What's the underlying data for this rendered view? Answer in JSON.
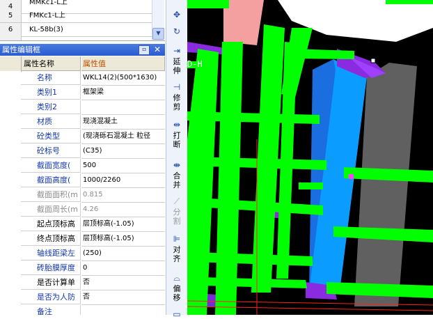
{
  "top_list": {
    "rows": [
      {
        "num": "4",
        "name": "MMKc1-L上"
      },
      {
        "num": "5",
        "name": "FMKc1-L上"
      },
      {
        "num": "6",
        "name": "KL-58b(3)"
      }
    ],
    "scroll_icon": "chevron-down-icon"
  },
  "panel": {
    "title": "属性编辑框",
    "pin_label": "ㅁ",
    "close_label": "✕",
    "header_name": "属性名称",
    "header_value": "属性值",
    "rows": [
      {
        "name": "名称",
        "value": "WKL14(2)(500*1630)",
        "style": "blue"
      },
      {
        "name": "类别1",
        "value": "框架梁",
        "style": "blue"
      },
      {
        "name": "类别2",
        "value": "",
        "style": "blue"
      },
      {
        "name": "材质",
        "value": "现浇混凝土",
        "style": "blue"
      },
      {
        "name": "砼类型",
        "value": "(现浇砾石混凝土 粒径",
        "style": "blue"
      },
      {
        "name": "砼标号",
        "value": "(C35)",
        "style": "blue"
      },
      {
        "name": "截面宽度(",
        "value": "500",
        "style": "blue"
      },
      {
        "name": "截面高度(",
        "value": "1000/2260",
        "style": "blue"
      },
      {
        "name": "截面面积(m",
        "value": "0.815",
        "style": "gray"
      },
      {
        "name": "截面周长(m",
        "value": "4.26",
        "style": "gray"
      },
      {
        "name": "起点顶标高",
        "value": "层顶标高(-1.05)",
        "style": "black"
      },
      {
        "name": "终点顶标高",
        "value": "层顶标高(-1.05)",
        "style": "black"
      },
      {
        "name": "轴线距梁左",
        "value": "(250)",
        "style": "blue"
      },
      {
        "name": "砖胎膜厚度",
        "value": "0",
        "style": "blue"
      },
      {
        "name": "是否计算单",
        "value": "否",
        "style": "black"
      },
      {
        "name": "是否为人防",
        "value": "否",
        "style": "blue"
      },
      {
        "name": "备注",
        "value": "",
        "style": "blue"
      }
    ]
  },
  "toolbar": {
    "items": [
      {
        "icon": "move-icon",
        "glyph": "✥",
        "label": "",
        "disabled": false
      },
      {
        "icon": "rotate-icon",
        "glyph": "↻",
        "label": "",
        "disabled": false
      },
      {
        "icon": "extend-icon",
        "glyph": "⇥",
        "label": "延伸",
        "disabled": false
      },
      {
        "icon": "trim-icon",
        "glyph": "⊣",
        "label": "修剪",
        "disabled": false
      },
      {
        "icon": "break-icon",
        "glyph": "⇹",
        "label": "打断",
        "disabled": false
      },
      {
        "icon": "merge-icon",
        "glyph": "⇼",
        "label": "合并",
        "disabled": false
      },
      {
        "icon": "split-icon",
        "glyph": "⟋",
        "label": "分割",
        "disabled": true
      },
      {
        "icon": "align-icon",
        "glyph": "⊫",
        "label": "对齐",
        "disabled": false
      },
      {
        "icon": "offset-icon",
        "glyph": "⌓",
        "label": "偏移",
        "disabled": false
      },
      {
        "icon": "stretch-icon",
        "glyph": "▭",
        "label": "",
        "disabled": false
      }
    ]
  },
  "view": {
    "axis_label": "D-H",
    "colors": {
      "beam": "#00ff00",
      "selected_beam": "#0077ff",
      "selected_beam_side": "#2a4ad8",
      "purple": "#8a2be2",
      "wall": "#606060",
      "slab": "#ffffff",
      "pink": "#f4a0a0",
      "background": "#000000"
    }
  }
}
